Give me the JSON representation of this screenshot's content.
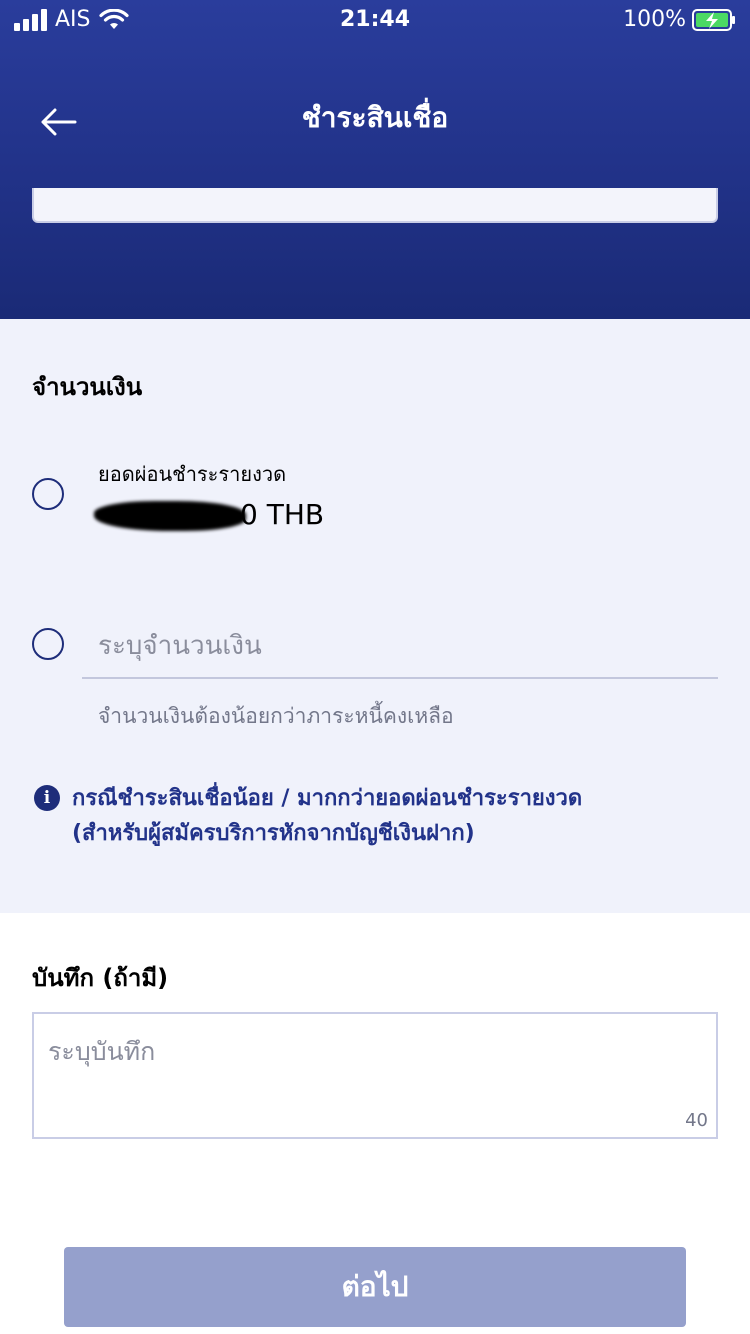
{
  "status_bar": {
    "carrier": "AIS",
    "time": "21:44",
    "battery": "100%"
  },
  "header": {
    "title": "ชำระสินเชื่อ",
    "back_icon": "arrow-left-icon"
  },
  "amount_section": {
    "label": "จำนวนเงิน",
    "option_installment": {
      "label": "ยอดผ่อนชำระรายงวด",
      "value": "0 THB",
      "selected": false
    },
    "option_custom": {
      "placeholder": "ระบุจำนวนเงิน",
      "value": "",
      "selected": false,
      "hint": "จำนวนเงินต้องน้อยกว่าภาระหนี้คงเหลือ"
    },
    "info_icon": "info-icon",
    "info_lines": [
      "กรณีชำระสินเชื่อน้อย / มากกว่ายอดผ่อนชำระรายงวด",
      "(สำหรับผู้สมัครบริการหักจากบัญชีเงินฝาก)"
    ]
  },
  "note_section": {
    "label": "บันทึก (ถ้ามี)",
    "placeholder": "ระบุบันทึก",
    "value": "",
    "counter": "40"
  },
  "next_button": {
    "label": "ต่อไป"
  },
  "colors": {
    "header_bg": "#22338a",
    "section_bg": "#f0f2fb",
    "accent": "#1e2d7a",
    "button_disabled": "#95a0cc"
  }
}
